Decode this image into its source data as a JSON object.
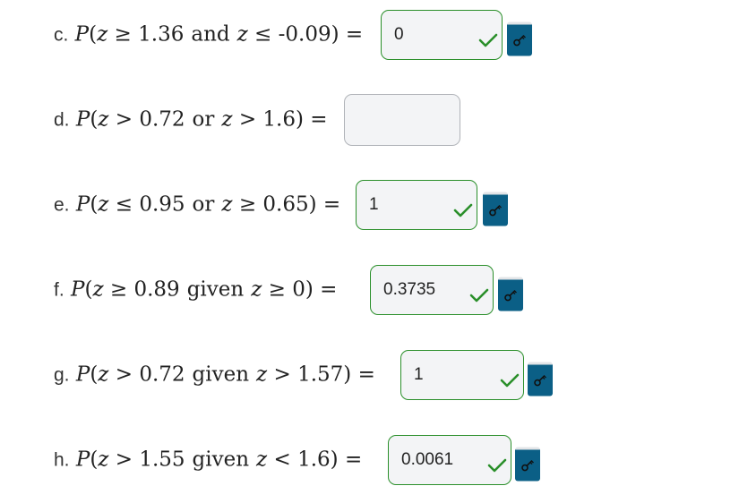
{
  "questions": [
    {
      "letter": "c.",
      "p": "P",
      "open": "(",
      "z1": "z",
      "rel1": " ≥ ",
      "num1": "1.36",
      "word": "and",
      "z2": "z",
      "rel2": " ≤ ",
      "num2": "-0.09",
      "close": ")",
      "eq": " = ",
      "answer": "0",
      "status": "correct"
    },
    {
      "letter": "d.",
      "p": "P",
      "open": "(",
      "z1": "z",
      "rel1": " > ",
      "num1": "0.72",
      "word": "or",
      "z2": "z",
      "rel2": " > ",
      "num2": "1.6",
      "close": ")",
      "eq": " = ",
      "answer": "",
      "status": "empty"
    },
    {
      "letter": "e.",
      "p": "P",
      "open": "(",
      "z1": "z",
      "rel1": " ≤ ",
      "num1": "0.95",
      "word": "or",
      "z2": "z",
      "rel2": " ≥ ",
      "num2": "0.65",
      "close": ")",
      "eq": " = ",
      "answer": "1",
      "status": "correct"
    },
    {
      "letter": "f.",
      "p": "P",
      "open": "(",
      "z1": "z",
      "rel1": " ≥ ",
      "num1": "0.89",
      "word": "given",
      "z2": "z",
      "rel2": " ≥ ",
      "num2": "0",
      "close": ")",
      "eq": " = ",
      "answer": "0.3735",
      "status": "correct"
    },
    {
      "letter": "g.",
      "p": "P",
      "open": "(",
      "z1": "z",
      "rel1": " > ",
      "num1": "0.72",
      "word": "given",
      "z2": "z",
      "rel2": " > ",
      "num2": "1.57",
      "close": ")",
      "eq": " = ",
      "answer": "1",
      "status": "correct"
    },
    {
      "letter": "h.",
      "p": "P",
      "open": "(",
      "z1": "z",
      "rel1": " > ",
      "num1": "1.55",
      "word": "given",
      "z2": "z",
      "rel2": " < ",
      "num2": "1.6",
      "close": ")",
      "eq": " = ",
      "answer": "0.0061",
      "status": "correct"
    }
  ],
  "icons": {
    "check": "checkmark-icon",
    "key": "key-icon"
  },
  "colors": {
    "correct_border": "#2a8f2a",
    "empty_border": "#b0b3b8",
    "check": "#2a8f2a",
    "key_button": "#0b5f86",
    "input_background": "#f3f4f6"
  }
}
